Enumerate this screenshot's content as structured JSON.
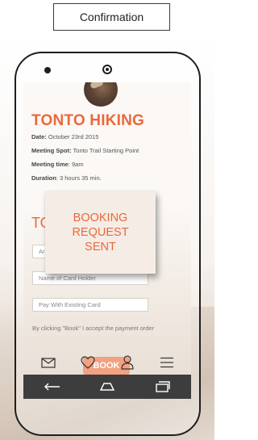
{
  "header_label": "Confirmation",
  "hike": {
    "title": "TONTO HIKING",
    "details": [
      {
        "key": "Date:",
        "value": " October 23rd 2015"
      },
      {
        "key": "Meeting Spot:",
        "value": " Tonto Trail Starting Point"
      },
      {
        "key": "Meeting time",
        "value": ":  9am"
      },
      {
        "key": "Duration",
        "value": ": 3 hours 35 min."
      }
    ]
  },
  "payment": {
    "heading_visible": "TO",
    "card_number_field_visible": "Ar",
    "card_holder_placeholder": "Name of Card Holder",
    "existing_card_label": "Pay With Existing Card",
    "terms": "By clicking \"Book\" I accept the payment order",
    "book_label": "BOOK"
  },
  "modal": {
    "line1": "BOOKING",
    "line2": "REQUEST",
    "line3": "SENT"
  },
  "icons": {
    "tabs": [
      "mail-icon",
      "heart-icon",
      "user-icon",
      "menu-icon"
    ],
    "nav": [
      "back-icon",
      "home-icon",
      "recent-apps-icon"
    ]
  },
  "colors": {
    "accent": "#e8693d",
    "nav_bar": "#3d3d3d"
  }
}
